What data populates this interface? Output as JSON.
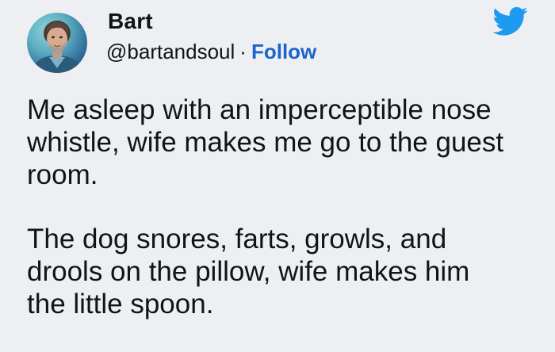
{
  "author": {
    "name": "Bart",
    "handle": "@bartandsoul",
    "separator": "·",
    "follow_label": "Follow",
    "avatar_icon": "profile-photo"
  },
  "brand": {
    "icon": "twitter-bird-icon",
    "color": "#1d9bf0"
  },
  "tweet": {
    "paragraph_1": "Me asleep with an imperceptible nose\nwhistle, wife makes me go to the guest\nroom.",
    "paragraph_2": "The dog snores, farts, growls, and\ndrools on the pillow, wife makes him\nthe little spoon."
  },
  "colors": {
    "background": "#eeeff3",
    "text": "#0f1419",
    "link": "#1d63c9"
  }
}
